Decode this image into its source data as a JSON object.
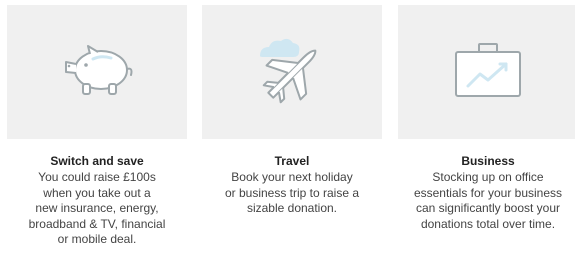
{
  "colors": {
    "tile_bg": "#f0f0f0",
    "icon_stroke": "#9ea7ab",
    "icon_fill": "#ffffff",
    "accent": "#cfe7f2"
  },
  "cards": [
    {
      "icon": "piggy-bank-icon",
      "title": "Switch and save",
      "description_lines": [
        "You could raise £100s",
        "when you take out a",
        "new insurance, energy,",
        "broadband & TV, financial",
        "or mobile deal."
      ]
    },
    {
      "icon": "airplane-icon",
      "title": "Travel",
      "description_lines": [
        "Book your next holiday",
        "or business trip to raise a",
        "sizable donation."
      ]
    },
    {
      "icon": "briefcase-icon",
      "title": "Business",
      "description_lines": [
        "Stocking up on office",
        "essentials for your business",
        "can significantly boost your",
        "donations total over time."
      ]
    }
  ]
}
